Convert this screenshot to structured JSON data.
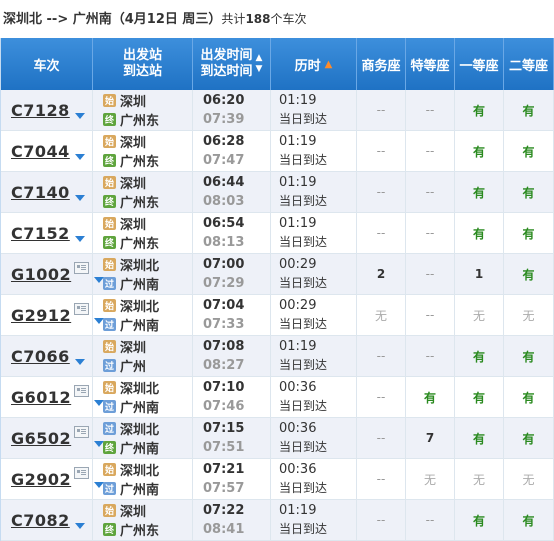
{
  "summary": {
    "route": "深圳北 --> 广州南",
    "date": "（4月12日  周三）",
    "total_prefix": "共计",
    "total_count": "188",
    "total_suffix": "个车次"
  },
  "headers": {
    "train": "车次",
    "station_line1": "出发站",
    "station_line2": "到达站",
    "time_line1": "出发时间",
    "time_line2": "到达时间",
    "duration": "历时",
    "business": "商务座",
    "special": "特等座",
    "first": "一等座",
    "second": "二等座"
  },
  "icons": {
    "start_badge": "始",
    "pass_badge": "过",
    "end_badge": "终"
  },
  "colors": {
    "header_blue": "#2b7fd3",
    "available_green": "#2a8a1f",
    "sort_orange": "#ff8b2a"
  },
  "rows": [
    {
      "train": "C7128",
      "id_icon": false,
      "from": "深圳",
      "from_type": "start",
      "to": "广州东",
      "to_type": "end",
      "dep": "06:20",
      "arr": "07:39",
      "dur": "01:19",
      "day": "当日到达",
      "business": "--",
      "special": "--",
      "first": "有",
      "second": "有"
    },
    {
      "train": "C7044",
      "id_icon": false,
      "from": "深圳",
      "from_type": "start",
      "to": "广州东",
      "to_type": "end",
      "dep": "06:28",
      "arr": "07:47",
      "dur": "01:19",
      "day": "当日到达",
      "business": "--",
      "special": "--",
      "first": "有",
      "second": "有"
    },
    {
      "train": "C7140",
      "id_icon": false,
      "from": "深圳",
      "from_type": "start",
      "to": "广州东",
      "to_type": "end",
      "dep": "06:44",
      "arr": "08:03",
      "dur": "01:19",
      "day": "当日到达",
      "business": "--",
      "special": "--",
      "first": "有",
      "second": "有"
    },
    {
      "train": "C7152",
      "id_icon": false,
      "from": "深圳",
      "from_type": "start",
      "to": "广州东",
      "to_type": "end",
      "dep": "06:54",
      "arr": "08:13",
      "dur": "01:19",
      "day": "当日到达",
      "business": "--",
      "special": "--",
      "first": "有",
      "second": "有"
    },
    {
      "train": "G1002",
      "id_icon": true,
      "from": "深圳北",
      "from_type": "start",
      "to": "广州南",
      "to_type": "pass",
      "dep": "07:00",
      "arr": "07:29",
      "dur": "00:29",
      "day": "当日到达",
      "business": "2",
      "special": "--",
      "first": "1",
      "second": "有"
    },
    {
      "train": "G2912",
      "id_icon": true,
      "from": "深圳北",
      "from_type": "start",
      "to": "广州南",
      "to_type": "pass",
      "dep": "07:04",
      "arr": "07:33",
      "dur": "00:29",
      "day": "当日到达",
      "business": "无",
      "special": "--",
      "first": "无",
      "second": "无"
    },
    {
      "train": "C7066",
      "id_icon": false,
      "from": "深圳",
      "from_type": "start",
      "to": "广州",
      "to_type": "pass",
      "dep": "07:08",
      "arr": "08:27",
      "dur": "01:19",
      "day": "当日到达",
      "business": "--",
      "special": "--",
      "first": "有",
      "second": "有"
    },
    {
      "train": "G6012",
      "id_icon": true,
      "from": "深圳北",
      "from_type": "start",
      "to": "广州南",
      "to_type": "pass",
      "dep": "07:10",
      "arr": "07:46",
      "dur": "00:36",
      "day": "当日到达",
      "business": "--",
      "special": "有",
      "first": "有",
      "second": "有"
    },
    {
      "train": "G6502",
      "id_icon": true,
      "from": "深圳北",
      "from_type": "pass",
      "to": "广州南",
      "to_type": "end",
      "dep": "07:15",
      "arr": "07:51",
      "dur": "00:36",
      "day": "当日到达",
      "business": "--",
      "special": "7",
      "first": "有",
      "second": "有"
    },
    {
      "train": "G2902",
      "id_icon": true,
      "from": "深圳北",
      "from_type": "start",
      "to": "广州南",
      "to_type": "pass",
      "dep": "07:21",
      "arr": "07:57",
      "dur": "00:36",
      "day": "当日到达",
      "business": "--",
      "special": "无",
      "first": "无",
      "second": "无"
    },
    {
      "train": "C7082",
      "id_icon": false,
      "from": "深圳",
      "from_type": "start",
      "to": "广州东",
      "to_type": "end",
      "dep": "07:22",
      "arr": "08:41",
      "dur": "01:19",
      "day": "当日到达",
      "business": "--",
      "special": "--",
      "first": "有",
      "second": "有"
    }
  ]
}
